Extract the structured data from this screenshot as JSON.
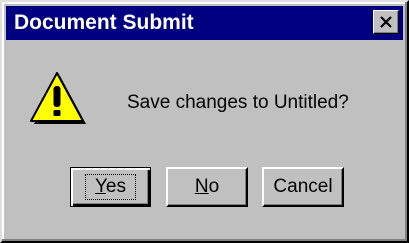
{
  "window": {
    "title": "Document Submit",
    "close_label": "Close"
  },
  "dialog": {
    "icon": "warning-icon",
    "message": "Save changes to Untitled?"
  },
  "buttons": {
    "yes": {
      "accel": "Y",
      "rest": "es"
    },
    "no": {
      "accel": "N",
      "rest": "o"
    },
    "cancel": {
      "label": "Cancel"
    }
  },
  "colors": {
    "titlebar": "#000080",
    "face": "#c0c0c0",
    "warning_fill": "#ffff00"
  }
}
